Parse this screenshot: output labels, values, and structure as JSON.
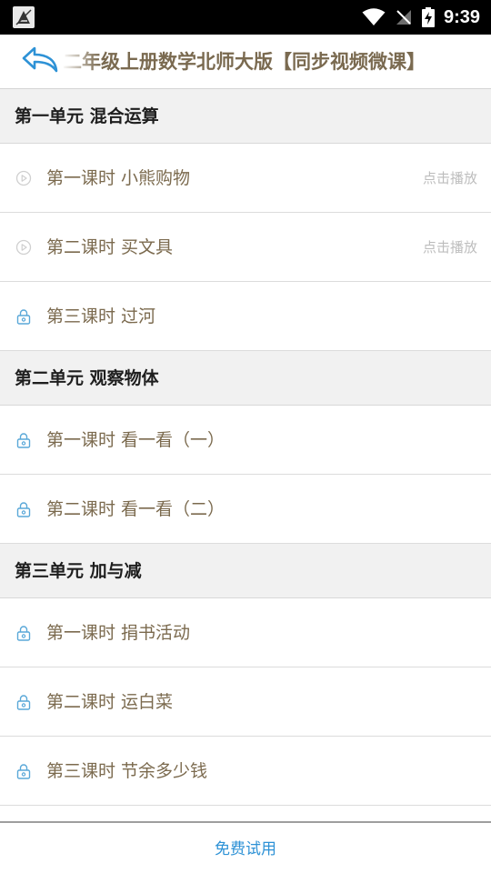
{
  "status_bar": {
    "time": "9:39",
    "icons": [
      "app-notification-icon",
      "wifi-icon",
      "no-signal-icon",
      "battery-charging-icon"
    ]
  },
  "header": {
    "title": "二年级上册数学北师大版【同步视频微课】",
    "back_icon": "back-arrow-icon"
  },
  "units": [
    {
      "title": "第一单元 混合运算",
      "lessons": [
        {
          "title": "第一课时 小熊购物",
          "icon": "play-icon",
          "action": "点击播放"
        },
        {
          "title": "第二课时 买文具",
          "icon": "play-icon",
          "action": "点击播放"
        },
        {
          "title": "第三课时 过河",
          "icon": "lock-icon",
          "action": ""
        }
      ]
    },
    {
      "title": "第二单元 观察物体",
      "lessons": [
        {
          "title": "第一课时 看一看（一）",
          "icon": "lock-icon",
          "action": ""
        },
        {
          "title": "第二课时 看一看（二）",
          "icon": "lock-icon",
          "action": ""
        }
      ]
    },
    {
      "title": "第三单元 加与减",
      "lessons": [
        {
          "title": "第一课时 捐书活动",
          "icon": "lock-icon",
          "action": ""
        },
        {
          "title": "第二课时 运白菜",
          "icon": "lock-icon",
          "action": ""
        },
        {
          "title": "第三课时 节余多少钱",
          "icon": "lock-icon",
          "action": ""
        }
      ]
    }
  ],
  "footer": {
    "trial_label": "免费试用"
  },
  "colors": {
    "accent": "#2e92d6",
    "lesson_text": "#7b6a4e",
    "unit_bg": "#f1f1f1"
  }
}
